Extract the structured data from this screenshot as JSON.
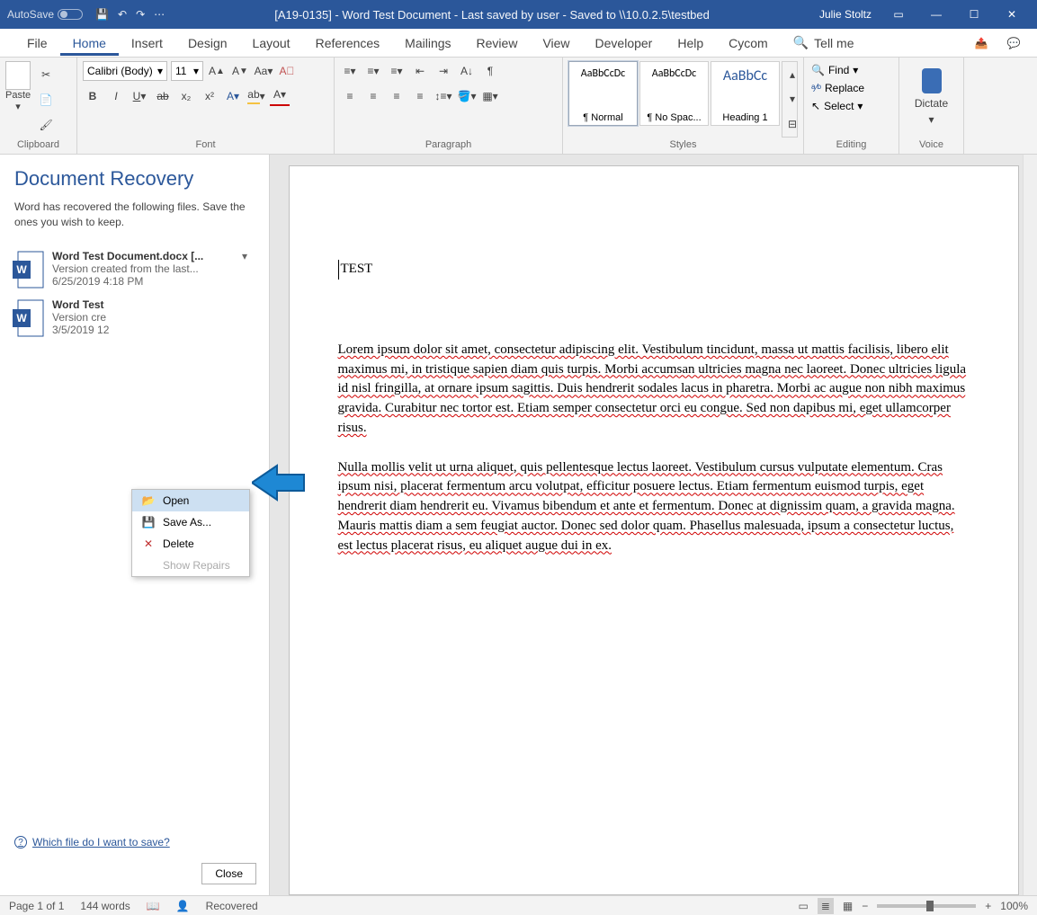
{
  "titlebar": {
    "autosave": "AutoSave",
    "title": "[A19-0135] - Word Test Document -  Last saved by user -  Saved to \\\\10.0.2.5\\testbed",
    "user": "Julie Stoltz"
  },
  "tabs": {
    "file": "File",
    "home": "Home",
    "insert": "Insert",
    "design": "Design",
    "layout": "Layout",
    "references": "References",
    "mailings": "Mailings",
    "review": "Review",
    "view": "View",
    "developer": "Developer",
    "help": "Help",
    "cycom": "Cycom",
    "tellme": "Tell me"
  },
  "ribbon": {
    "clipboard": {
      "paste": "Paste",
      "label": "Clipboard"
    },
    "font": {
      "name": "Calibri (Body)",
      "size": "11",
      "label": "Font"
    },
    "paragraph": {
      "label": "Paragraph"
    },
    "styles": {
      "label": "Styles",
      "items": [
        {
          "preview": "AaBbCcDc",
          "name": "¶ Normal"
        },
        {
          "preview": "AaBbCcDc",
          "name": "¶ No Spac..."
        },
        {
          "preview": "AaBbCc",
          "name": "Heading 1"
        }
      ]
    },
    "editing": {
      "find": "Find",
      "replace": "Replace",
      "select": "Select",
      "label": "Editing"
    },
    "voice": {
      "dictate": "Dictate",
      "label": "Voice"
    }
  },
  "recovery": {
    "title": "Document Recovery",
    "msg": "Word has recovered the following files. Save the ones you wish to keep.",
    "items": [
      {
        "name": "Word Test Document.docx  [...",
        "desc": "Version created from the last...",
        "date": "6/25/2019 4:18 PM"
      },
      {
        "name": "Word Test",
        "desc": "Version cre",
        "date": "3/5/2019 12"
      }
    ],
    "menu": {
      "open": "Open",
      "saveas": "Save As...",
      "delete": "Delete",
      "repairs": "Show Repairs"
    },
    "which": "Which file do I want to save?",
    "close": "Close"
  },
  "document": {
    "heading": "TEST",
    "p1": "Lorem ipsum dolor sit amet, consectetur adipiscing elit. Vestibulum tincidunt, massa ut mattis facilisis, libero elit maximus mi, in tristique sapien diam quis turpis. Morbi accumsan ultricies magna nec laoreet. Donec ultricies ligula id nisl fringilla, at ornare ipsum sagittis. Duis hendrerit sodales lacus in pharetra. Morbi ac augue non nibh maximus gravida. Curabitur nec tortor est. Etiam semper consectetur orci eu congue. Sed non dapibus mi, eget ullamcorper risus.",
    "p2": "Nulla mollis velit ut urna aliquet, quis pellentesque lectus laoreet. Vestibulum cursus vulputate elementum. Cras ipsum nisi, placerat fermentum arcu volutpat, efficitur posuere lectus. Etiam fermentum euismod turpis, eget hendrerit diam hendrerit eu. Vivamus bibendum et ante et fermentum. Donec at dignissim quam, a gravida magna. Mauris mattis diam a sem feugiat auctor. Donec sed dolor quam. Phasellus malesuada, ipsum a consectetur luctus, est lectus placerat risus, eu aliquet augue dui in ex."
  },
  "statusbar": {
    "page": "Page 1 of 1",
    "words": "144 words",
    "recovered": "Recovered",
    "zoom": "100%"
  }
}
